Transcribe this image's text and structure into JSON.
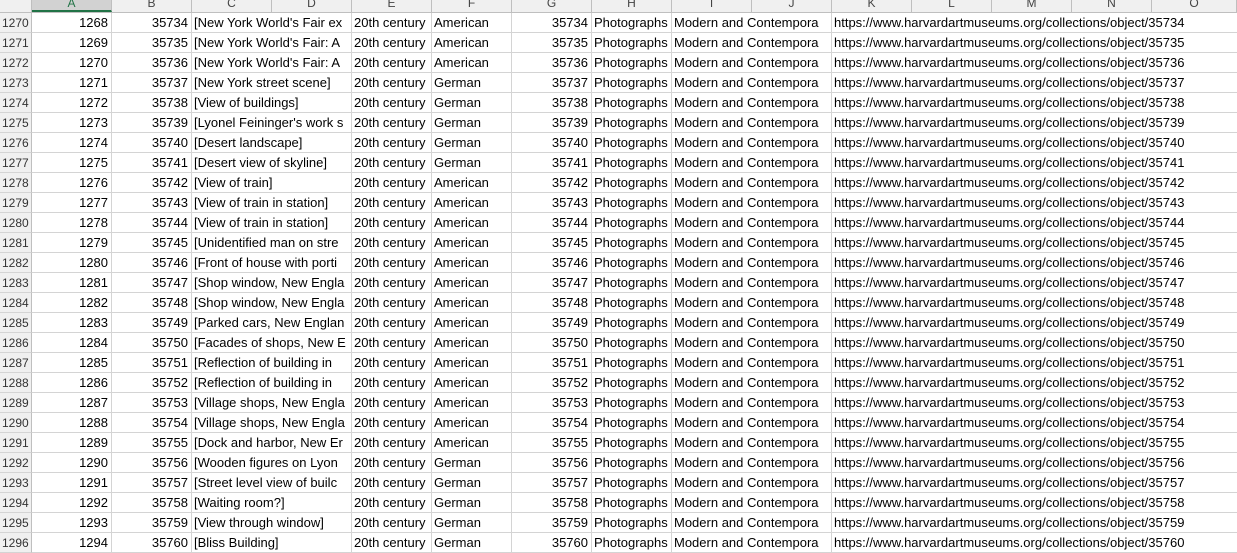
{
  "sheet": {
    "columns": [
      "A",
      "B",
      "C",
      "D",
      "E",
      "F",
      "G",
      "H",
      "I",
      "J",
      "K",
      "L",
      "M",
      "N",
      "O"
    ],
    "selected_column": "A",
    "rows": [
      {
        "row": "1270",
        "a": "1268",
        "b": "35734",
        "c": "[New York World's Fair ex",
        "e": "20th century",
        "f": "American",
        "g": "35734",
        "h": "Photographs",
        "i": "Modern and Contempora",
        "k": "https://www.harvardartmuseums.org/collections/object/35734"
      },
      {
        "row": "1271",
        "a": "1269",
        "b": "35735",
        "c": "[New York World's Fair: A",
        "e": "20th century",
        "f": "American",
        "g": "35735",
        "h": "Photographs",
        "i": "Modern and Contempora",
        "k": "https://www.harvardartmuseums.org/collections/object/35735"
      },
      {
        "row": "1272",
        "a": "1270",
        "b": "35736",
        "c": "[New York World's Fair: A",
        "e": "20th century",
        "f": "American",
        "g": "35736",
        "h": "Photographs",
        "i": "Modern and Contempora",
        "k": "https://www.harvardartmuseums.org/collections/object/35736"
      },
      {
        "row": "1273",
        "a": "1271",
        "b": "35737",
        "c": "[New York street scene]",
        "e": "20th century",
        "f": "German",
        "g": "35737",
        "h": "Photographs",
        "i": "Modern and Contempora",
        "k": "https://www.harvardartmuseums.org/collections/object/35737"
      },
      {
        "row": "1274",
        "a": "1272",
        "b": "35738",
        "c": "[View of buildings]",
        "e": "20th century",
        "f": "German",
        "g": "35738",
        "h": "Photographs",
        "i": "Modern and Contempora",
        "k": "https://www.harvardartmuseums.org/collections/object/35738"
      },
      {
        "row": "1275",
        "a": "1273",
        "b": "35739",
        "c": "[Lyonel Feininger's work s",
        "e": "20th century",
        "f": "German",
        "g": "35739",
        "h": "Photographs",
        "i": "Modern and Contempora",
        "k": "https://www.harvardartmuseums.org/collections/object/35739"
      },
      {
        "row": "1276",
        "a": "1274",
        "b": "35740",
        "c": "[Desert landscape]",
        "e": "20th century",
        "f": "German",
        "g": "35740",
        "h": "Photographs",
        "i": "Modern and Contempora",
        "k": "https://www.harvardartmuseums.org/collections/object/35740"
      },
      {
        "row": "1277",
        "a": "1275",
        "b": "35741",
        "c": "[Desert view of skyline]",
        "e": "20th century",
        "f": "German",
        "g": "35741",
        "h": "Photographs",
        "i": "Modern and Contempora",
        "k": "https://www.harvardartmuseums.org/collections/object/35741"
      },
      {
        "row": "1278",
        "a": "1276",
        "b": "35742",
        "c": "[View of train]",
        "e": "20th century",
        "f": "American",
        "g": "35742",
        "h": "Photographs",
        "i": "Modern and Contempora",
        "k": "https://www.harvardartmuseums.org/collections/object/35742"
      },
      {
        "row": "1279",
        "a": "1277",
        "b": "35743",
        "c": "[View of train in station]",
        "e": "20th century",
        "f": "American",
        "g": "35743",
        "h": "Photographs",
        "i": "Modern and Contempora",
        "k": "https://www.harvardartmuseums.org/collections/object/35743"
      },
      {
        "row": "1280",
        "a": "1278",
        "b": "35744",
        "c": "[View of train in station]",
        "e": "20th century",
        "f": "American",
        "g": "35744",
        "h": "Photographs",
        "i": "Modern and Contempora",
        "k": "https://www.harvardartmuseums.org/collections/object/35744"
      },
      {
        "row": "1281",
        "a": "1279",
        "b": "35745",
        "c": "[Unidentified man on stre",
        "e": "20th century",
        "f": "American",
        "g": "35745",
        "h": "Photographs",
        "i": "Modern and Contempora",
        "k": "https://www.harvardartmuseums.org/collections/object/35745"
      },
      {
        "row": "1282",
        "a": "1280",
        "b": "35746",
        "c": "[Front of house with porti",
        "e": "20th century",
        "f": "American",
        "g": "35746",
        "h": "Photographs",
        "i": "Modern and Contempora",
        "k": "https://www.harvardartmuseums.org/collections/object/35746"
      },
      {
        "row": "1283",
        "a": "1281",
        "b": "35747",
        "c": "[Shop window, New Engla",
        "e": "20th century",
        "f": "American",
        "g": "35747",
        "h": "Photographs",
        "i": "Modern and Contempora",
        "k": "https://www.harvardartmuseums.org/collections/object/35747"
      },
      {
        "row": "1284",
        "a": "1282",
        "b": "35748",
        "c": "[Shop window, New Engla",
        "e": "20th century",
        "f": "American",
        "g": "35748",
        "h": "Photographs",
        "i": "Modern and Contempora",
        "k": "https://www.harvardartmuseums.org/collections/object/35748"
      },
      {
        "row": "1285",
        "a": "1283",
        "b": "35749",
        "c": "[Parked cars, New Englan",
        "e": "20th century",
        "f": "American",
        "g": "35749",
        "h": "Photographs",
        "i": "Modern and Contempora",
        "k": "https://www.harvardartmuseums.org/collections/object/35749"
      },
      {
        "row": "1286",
        "a": "1284",
        "b": "35750",
        "c": "[Facades of shops, New E",
        "e": "20th century",
        "f": "American",
        "g": "35750",
        "h": "Photographs",
        "i": "Modern and Contempora",
        "k": "https://www.harvardartmuseums.org/collections/object/35750"
      },
      {
        "row": "1287",
        "a": "1285",
        "b": "35751",
        "c": "[Reflection of building in",
        "e": "20th century",
        "f": "American",
        "g": "35751",
        "h": "Photographs",
        "i": "Modern and Contempora",
        "k": "https://www.harvardartmuseums.org/collections/object/35751"
      },
      {
        "row": "1288",
        "a": "1286",
        "b": "35752",
        "c": "[Reflection of building in",
        "e": "20th century",
        "f": "American",
        "g": "35752",
        "h": "Photographs",
        "i": "Modern and Contempora",
        "k": "https://www.harvardartmuseums.org/collections/object/35752"
      },
      {
        "row": "1289",
        "a": "1287",
        "b": "35753",
        "c": "[Village shops, New Engla",
        "e": "20th century",
        "f": "American",
        "g": "35753",
        "h": "Photographs",
        "i": "Modern and Contempora",
        "k": "https://www.harvardartmuseums.org/collections/object/35753"
      },
      {
        "row": "1290",
        "a": "1288",
        "b": "35754",
        "c": "[Village shops, New Engla",
        "e": "20th century",
        "f": "American",
        "g": "35754",
        "h": "Photographs",
        "i": "Modern and Contempora",
        "k": "https://www.harvardartmuseums.org/collections/object/35754"
      },
      {
        "row": "1291",
        "a": "1289",
        "b": "35755",
        "c": "[Dock and harbor, New Er",
        "e": "20th century",
        "f": "American",
        "g": "35755",
        "h": "Photographs",
        "i": "Modern and Contempora",
        "k": "https://www.harvardartmuseums.org/collections/object/35755"
      },
      {
        "row": "1292",
        "a": "1290",
        "b": "35756",
        "c": "[Wooden figures on Lyon",
        "e": "20th century",
        "f": "German",
        "g": "35756",
        "h": "Photographs",
        "i": "Modern and Contempora",
        "k": "https://www.harvardartmuseums.org/collections/object/35756"
      },
      {
        "row": "1293",
        "a": "1291",
        "b": "35757",
        "c": "[Street level view of builc",
        "e": "20th century",
        "f": "German",
        "g": "35757",
        "h": "Photographs",
        "i": "Modern and Contempora",
        "k": "https://www.harvardartmuseums.org/collections/object/35757"
      },
      {
        "row": "1294",
        "a": "1292",
        "b": "35758",
        "c": "[Waiting room?]",
        "e": "20th century",
        "f": "German",
        "g": "35758",
        "h": "Photographs",
        "i": "Modern and Contempora",
        "k": "https://www.harvardartmuseums.org/collections/object/35758"
      },
      {
        "row": "1295",
        "a": "1293",
        "b": "35759",
        "c": "[View through window]",
        "e": "20th century",
        "f": "German",
        "g": "35759",
        "h": "Photographs",
        "i": "Modern and Contempora",
        "k": "https://www.harvardartmuseums.org/collections/object/35759"
      },
      {
        "row": "1296",
        "a": "1294",
        "b": "35760",
        "c": "[Bliss Building]",
        "e": "20th century",
        "f": "German",
        "g": "35760",
        "h": "Photographs",
        "i": "Modern and Contempora",
        "k": "https://www.harvardartmuseums.org/collections/object/35760"
      }
    ]
  }
}
